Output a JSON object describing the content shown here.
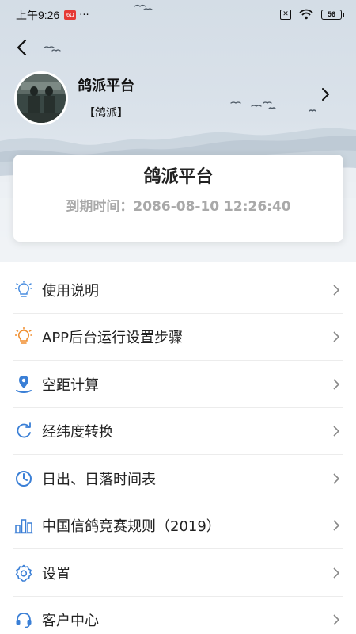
{
  "status_bar": {
    "time": "上午9:26",
    "badge": "6Ω",
    "dots": "···",
    "battery": "56"
  },
  "profile": {
    "name": "鸽派平台",
    "tag": "【鸽派】"
  },
  "card": {
    "title": "鸽派平台",
    "expiry": "到期时间：2086-08-10 12:26:40"
  },
  "menu": {
    "items": [
      {
        "label": "使用说明",
        "icon": "lightbulb-icon",
        "color": "#4a8ee0"
      },
      {
        "label": "APP后台运行设置步骤",
        "icon": "lightbulb-icon",
        "color": "#f08c2a"
      },
      {
        "label": "空距计算",
        "icon": "location-pin-icon",
        "color": "#3a7fd6"
      },
      {
        "label": "经纬度转换",
        "icon": "refresh-icon",
        "color": "#3a7fd6"
      },
      {
        "label": "日出、日落时间表",
        "icon": "clock-icon",
        "color": "#3a7fd6"
      },
      {
        "label": "中国信鸽竞赛规则（2019）",
        "icon": "bar-chart-icon",
        "color": "#3a7fd6"
      },
      {
        "label": "设置",
        "icon": "gear-icon",
        "color": "#3a7fd6"
      },
      {
        "label": "客户中心",
        "icon": "headset-icon",
        "color": "#3a7fd6"
      }
    ]
  }
}
